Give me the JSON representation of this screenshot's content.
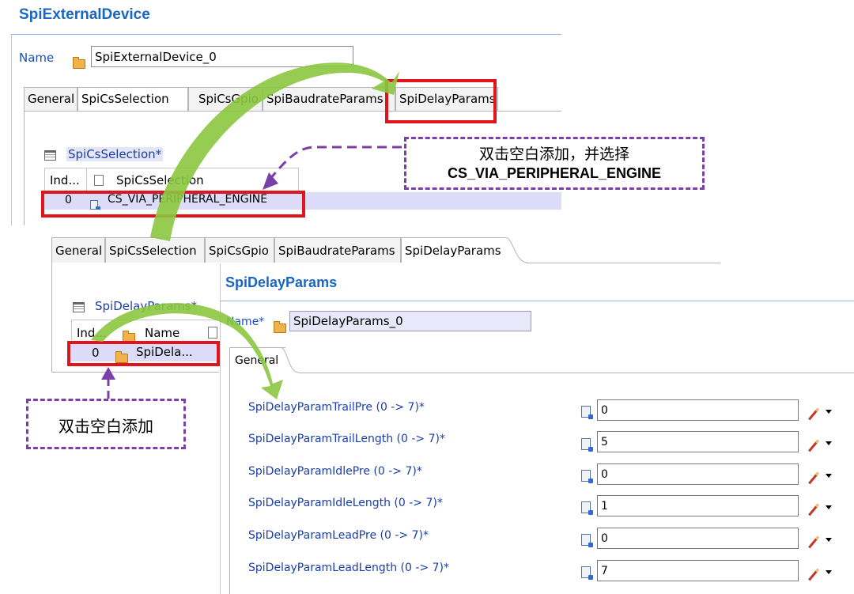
{
  "top_panel": {
    "title": "SpiExternalDevice",
    "name_label": "Name",
    "name_value": "SpiExternalDevice_0",
    "tabs": [
      {
        "label": "General"
      },
      {
        "label": "SpiCsSelection"
      },
      {
        "label": "SpiCsGpio"
      },
      {
        "label": "SpiBaudrateParams"
      },
      {
        "label": "SpiDelayParams"
      }
    ],
    "table_title": "SpiCsSelection*",
    "col_index": "Ind...",
    "col_value": "SpiCsSelection",
    "row_index": "0",
    "row_value": "CS_VIA_PERIPHERAL_ENGINE"
  },
  "callout_top": {
    "line1": "双击空白添加，并选择",
    "line2": "CS_VIA_PERIPHERAL_ENGINE"
  },
  "bottom_panel": {
    "tabs": [
      {
        "label": "General"
      },
      {
        "label": "SpiCsSelection"
      },
      {
        "label": "SpiCsGpio"
      },
      {
        "label": "SpiBaudrateParams"
      },
      {
        "label": "SpiDelayParams"
      }
    ],
    "list_title": "SpiDelayParams*",
    "col_index": "Ind...",
    "col_name": "Name",
    "row_index": "0",
    "row_name": "SpiDela..."
  },
  "callout_bottom": {
    "text": "双击空白添加"
  },
  "detail": {
    "title": "SpiDelayParams",
    "name_label": "Name*",
    "name_value": "SpiDelayParams_0",
    "inner_tab": "General",
    "params": [
      {
        "label": "SpiDelayParamTrailPre (0 -> 7)*",
        "value": "0"
      },
      {
        "label": "SpiDelayParamTrailLength (0 -> 7)*",
        "value": "5"
      },
      {
        "label": "SpiDelayParamIdlePre (0 -> 7)*",
        "value": "0"
      },
      {
        "label": "SpiDelayParamIdleLength (0 -> 7)*",
        "value": "1"
      },
      {
        "label": "SpiDelayParamLeadPre (0 -> 7)*",
        "value": "0"
      },
      {
        "label": "SpiDelayParamLeadLength (0 -> 7)*",
        "value": "7"
      }
    ]
  },
  "colors": {
    "title_blue": "#1a66c2",
    "highlight_red": "#e0141c",
    "callout_purple": "#7b3fa8",
    "arrow_green": "#8cc63f",
    "selection_bg": "#dcdcf8"
  }
}
